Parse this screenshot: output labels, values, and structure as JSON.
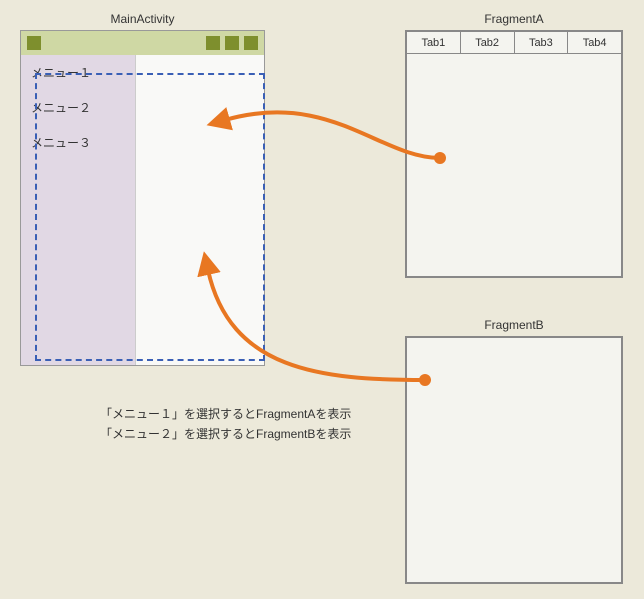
{
  "mainActivity": {
    "title": "MainActivity",
    "menu": [
      "メニュー１",
      "メニュー２",
      "メニュー３"
    ]
  },
  "fragmentA": {
    "title": "FragmentA",
    "tabs": [
      "Tab1",
      "Tab2",
      "Tab3",
      "Tab4"
    ]
  },
  "fragmentB": {
    "title": "FragmentB"
  },
  "captions": [
    "「メニュー１」を選択するとFragmentAを表示",
    "「メニュー２」を選択するとFragmentBを表示"
  ],
  "colors": {
    "arrow": "#e87722",
    "dashedBorder": "#3a5fb5",
    "toolbarDark": "#7e8f2d"
  }
}
